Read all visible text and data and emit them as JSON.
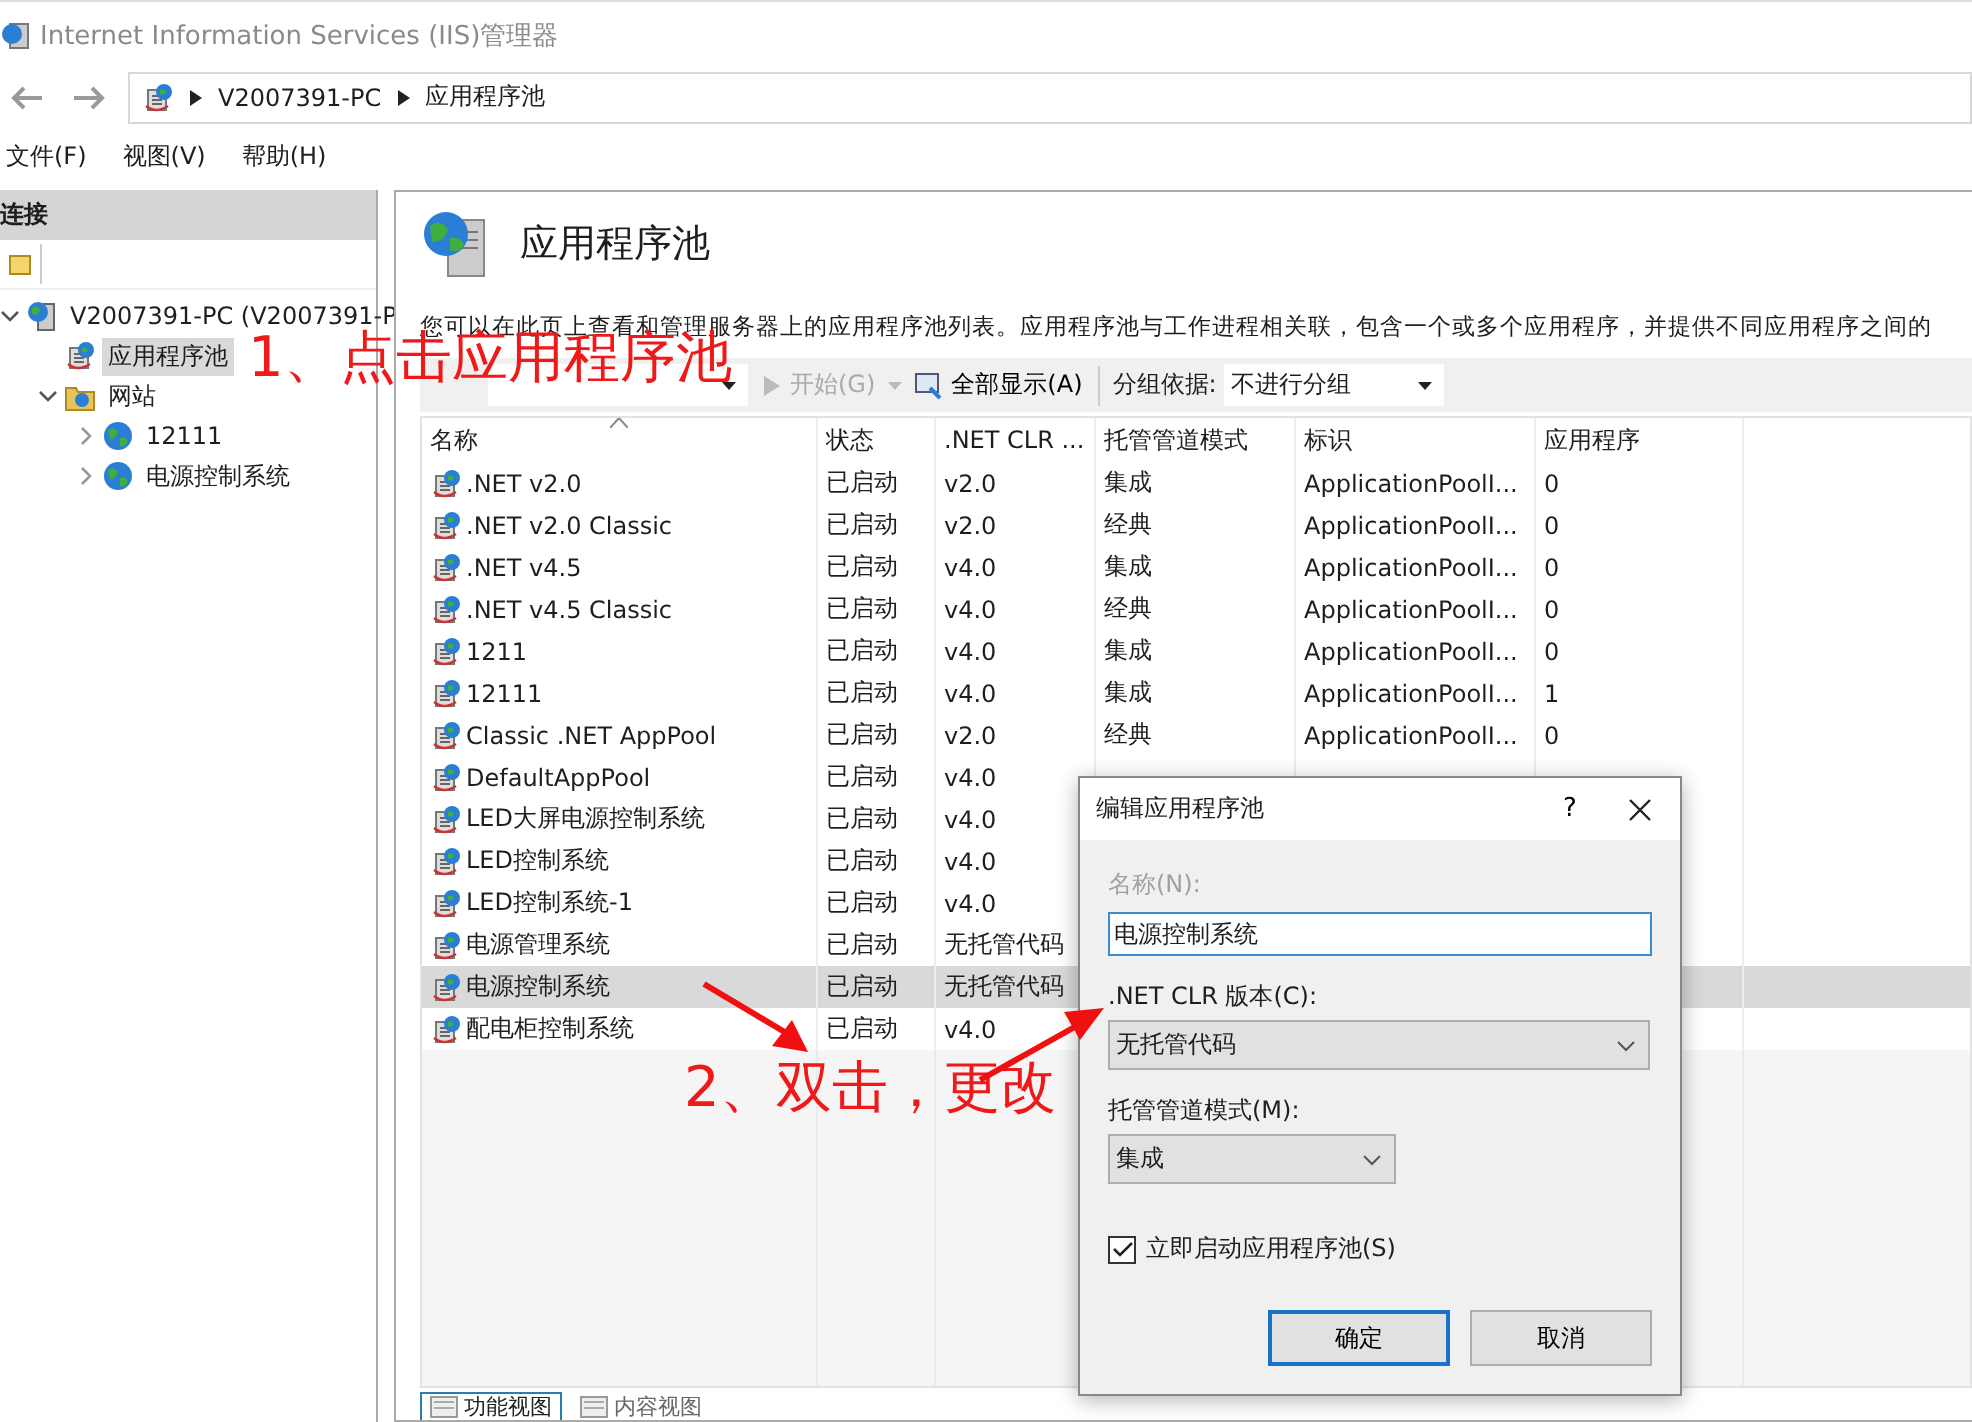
{
  "window": {
    "title": "Internet Information Services (IIS)管理器"
  },
  "breadcrumb": [
    "V2007391-PC",
    "应用程序池"
  ],
  "menu": [
    "文件(F)",
    "视图(V)",
    "帮助(H)"
  ],
  "connections": {
    "title": "连接",
    "tree": [
      {
        "label": "V2007391-PC (V2007391-P",
        "kind": "server",
        "expanded": true,
        "selected": false,
        "children": [
          {
            "label": "应用程序池",
            "kind": "pool",
            "selected": true
          },
          {
            "label": "网站",
            "kind": "sites",
            "expanded": true,
            "selected": false,
            "children": [
              {
                "label": "12111",
                "kind": "site",
                "expanded": false,
                "selected": false
              },
              {
                "label": "电源控制系统",
                "kind": "site",
                "expanded": false,
                "selected": false
              }
            ]
          }
        ]
      }
    ]
  },
  "main": {
    "title": "应用程序池",
    "description": "您可以在此页上查看和管理服务器上的应用程序池列表。应用程序池与工作进程相关联，包含一个或多个应用程序，并提供不同应用程序之间的",
    "toolbar": {
      "start": "开始(G)",
      "show_all": "全部显示(A)",
      "group_label": "分组依据:",
      "group_value": "不进行分组"
    },
    "table": {
      "columns": [
        "名称",
        "状态",
        ".NET CLR ...",
        "托管管道模式",
        "标识",
        "应用程序"
      ],
      "rows": [
        {
          "selected": false,
          "cells": [
            ".NET v2.0",
            "已启动",
            "v2.0",
            "集成",
            "ApplicationPoolI...",
            "0"
          ]
        },
        {
          "selected": false,
          "cells": [
            ".NET v2.0 Classic",
            "已启动",
            "v2.0",
            "经典",
            "ApplicationPoolI...",
            "0"
          ]
        },
        {
          "selected": false,
          "cells": [
            ".NET v4.5",
            "已启动",
            "v4.0",
            "集成",
            "ApplicationPoolI...",
            "0"
          ]
        },
        {
          "selected": false,
          "cells": [
            ".NET v4.5 Classic",
            "已启动",
            "v4.0",
            "经典",
            "ApplicationPoolI...",
            "0"
          ]
        },
        {
          "selected": false,
          "cells": [
            "1211",
            "已启动",
            "v4.0",
            "集成",
            "ApplicationPoolI...",
            "0"
          ]
        },
        {
          "selected": false,
          "cells": [
            "12111",
            "已启动",
            "v4.0",
            "集成",
            "ApplicationPoolI...",
            "1"
          ]
        },
        {
          "selected": false,
          "cells": [
            "Classic .NET AppPool",
            "已启动",
            "v2.0",
            "经典",
            "ApplicationPoolI...",
            "0"
          ]
        },
        {
          "selected": false,
          "cells": [
            "DefaultAppPool",
            "已启动",
            "v4.0"
          ]
        },
        {
          "selected": false,
          "cells": [
            "LED大屏电源控制系统",
            "已启动",
            "v4.0"
          ]
        },
        {
          "selected": false,
          "cells": [
            "LED控制系统",
            "已启动",
            "v4.0"
          ]
        },
        {
          "selected": false,
          "cells": [
            "LED控制系统-1",
            "已启动",
            "v4.0"
          ]
        },
        {
          "selected": false,
          "cells": [
            "电源管理系统",
            "已启动",
            "无托管代码"
          ]
        },
        {
          "selected": true,
          "cells": [
            "电源控制系统",
            "已启动",
            "无托管代码"
          ]
        },
        {
          "selected": false,
          "cells": [
            "配电柜控制系统",
            "已启动",
            "v4.0"
          ]
        }
      ]
    }
  },
  "view_tabs": [
    {
      "label": "功能视图",
      "selected": true
    },
    {
      "label": "内容视图",
      "selected": false
    }
  ],
  "dialog": {
    "title": "编辑应用程序池",
    "help": "?",
    "name_label": "名称(N):",
    "name_disabled": true,
    "name_value": "电源控制系统",
    "clr_label": ".NET CLR 版本(C):",
    "clr_value": "无托管代码",
    "mode_label": "托管管道模式(M):",
    "mode_value": "集成",
    "autostart": {
      "label": "立即启动应用程序池(S)",
      "checked": true
    },
    "buttons": [
      {
        "label": "确定",
        "default": true
      },
      {
        "label": "取消",
        "default": false
      }
    ]
  },
  "annotations": [
    {
      "text": "1、点击应用程序池"
    },
    {
      "text": "2、双击，更改"
    }
  ]
}
